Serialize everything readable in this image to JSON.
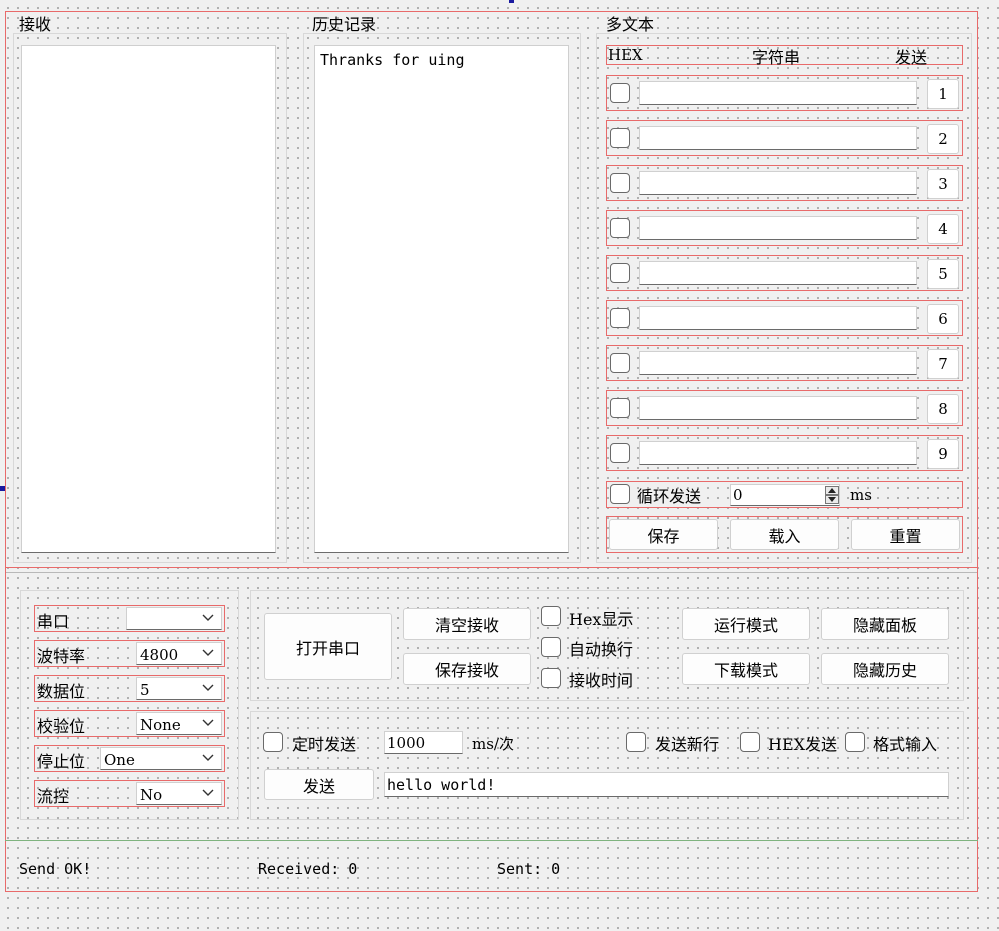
{
  "receive": {
    "title": "接收"
  },
  "history": {
    "title": "历史记录",
    "content": "Thranks for uing"
  },
  "multitext": {
    "title": "多文本",
    "col_hex": "HEX",
    "col_string": "字符串",
    "col_send": "发送",
    "rows": [
      "1",
      "2",
      "3",
      "4",
      "5",
      "6",
      "7",
      "8",
      "9"
    ],
    "loop_label": "循环发送",
    "loop_value": "0",
    "loop_unit": "ms",
    "save_label": "保存",
    "load_label": "载入",
    "reset_label": "重置"
  },
  "serial": {
    "port_label": "串口",
    "port_value": "",
    "baud_label": "波特率",
    "baud_value": "4800",
    "data_label": "数据位",
    "data_value": "5",
    "parity_label": "校验位",
    "parity_value": "None",
    "stop_label": "停止位",
    "stop_value": "One",
    "flow_label": "流控",
    "flow_value": "No"
  },
  "actions": {
    "open_port": "打开串口",
    "clear_receive": "清空接收",
    "save_receive": "保存接收",
    "hex_display": "Hex显示",
    "auto_newline": "自动换行",
    "receive_time": "接收时间",
    "run_mode": "运行模式",
    "download_mode": "下载模式",
    "hide_panel": "隐藏面板",
    "hide_history": "隐藏历史"
  },
  "send": {
    "timed_send": "定时发送",
    "interval_value": "1000",
    "interval_unit": "ms/次",
    "send_newline": "发送新行",
    "hex_send": "HEX发送",
    "format_input": "格式输入",
    "send_button": "发送",
    "send_text": "hello world!"
  },
  "status": {
    "message": "Send OK!",
    "received": "Received: 0",
    "sent": "Sent: 0"
  }
}
